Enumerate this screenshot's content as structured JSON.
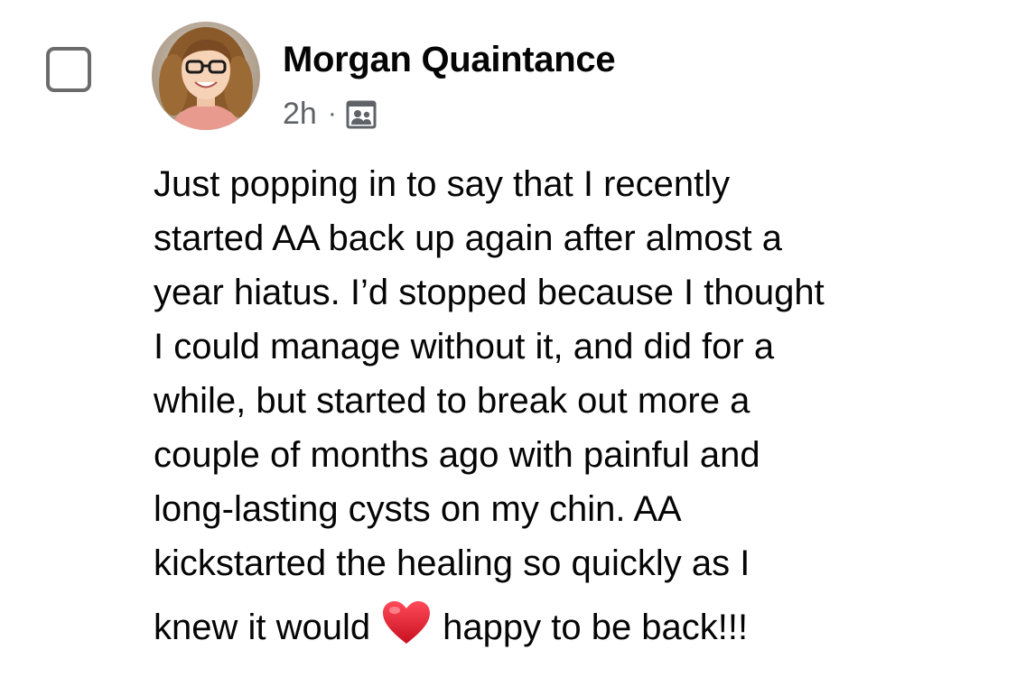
{
  "post": {
    "author_name": "Morgan Quaintance",
    "timestamp": "2h",
    "meta_separator": "·",
    "audience_icon": "group-members-icon",
    "body_lines": [
      "Just popping in to say that I recently",
      "started AA back up again after almost a",
      "year hiatus. I’d stopped because I thought",
      "I could manage without it, and did for a",
      "while, but started to break out more a",
      "couple of months ago with painful and",
      "long-lasting cysts on my chin. AA",
      "kickstarted the healing so quickly as I"
    ],
    "last_line": {
      "before_emoji": "knew it would",
      "emoji": "red-heart-emoji",
      "after_emoji": "happy to be back!!!"
    }
  },
  "selection": {
    "checked": false
  },
  "colors": {
    "text": "#050505",
    "meta_text": "#5f6368",
    "checkbox_border": "#6b6b6b",
    "heart": "#e0182c"
  }
}
